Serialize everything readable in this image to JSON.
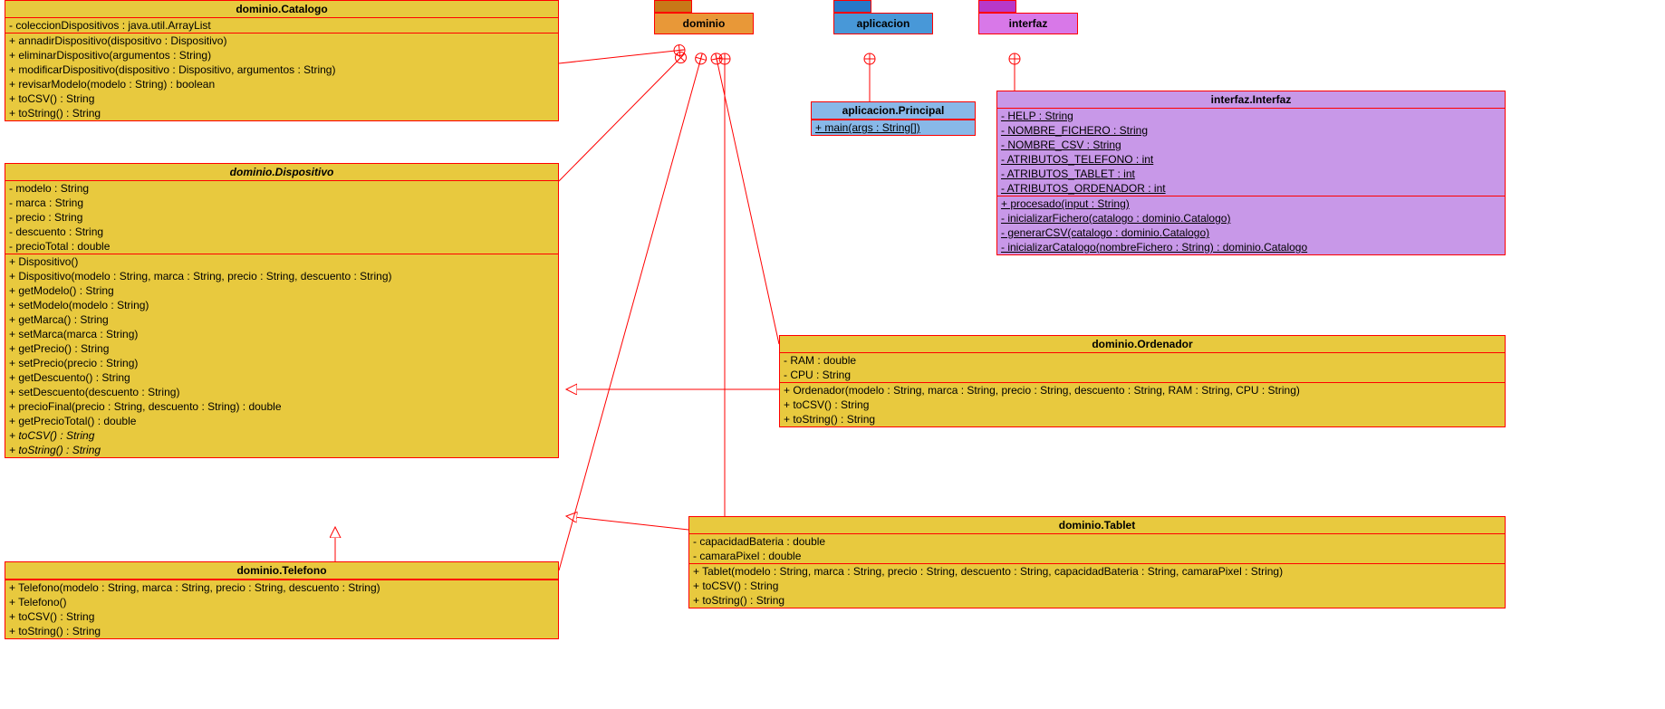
{
  "pkgs": {
    "dominio": "dominio",
    "aplicacion": "aplicacion",
    "interfaz": "interfaz"
  },
  "catalogo": {
    "title": "dominio.Catalogo",
    "a0": "- coleccionDispositivos : java.util.ArrayList",
    "m0": "+ annadirDispositivo(dispositivo : Dispositivo)",
    "m1": "+ eliminarDispositivo(argumentos : String)",
    "m2": "+ modificarDispositivo(dispositivo : Dispositivo, argumentos : String)",
    "m3": "+ revisarModelo(modelo : String) : boolean",
    "m4": "+ toCSV() : String",
    "m5": "+ toString() : String"
  },
  "disp": {
    "title": "dominio.Dispositivo",
    "a0": "- modelo : String",
    "a1": "- marca : String",
    "a2": "- precio : String",
    "a3": "- descuento : String",
    "a4": "- precioTotal : double",
    "m0": "+ Dispositivo()",
    "m1": "+ Dispositivo(modelo : String, marca : String, precio : String, descuento : String)",
    "m2": "+ getModelo() : String",
    "m3": "+ setModelo(modelo : String)",
    "m4": "+ getMarca() : String",
    "m5": "+ setMarca(marca : String)",
    "m6": "+ getPrecio() : String",
    "m7": "+ setPrecio(precio : String)",
    "m8": "+ getDescuento() : String",
    "m9": "+ setDescuento(descuento : String)",
    "m10": "+ precioFinal(precio : String, descuento : String) : double",
    "m11": "+ getPrecioTotal() : double",
    "m12": "+ toCSV() : String",
    "m13": "+ toString() : String"
  },
  "tel": {
    "title": "dominio.Telefono",
    "m0": "+ Telefono(modelo : String, marca : String, precio : String, descuento : String)",
    "m1": "+ Telefono()",
    "m2": "+ toCSV() : String",
    "m3": "+ toString() : String"
  },
  "ord": {
    "title": "dominio.Ordenador",
    "a0": "- RAM : double",
    "a1": "- CPU : String",
    "m0": "+ Ordenador(modelo : String, marca : String, precio : String, descuento : String, RAM : String, CPU : String)",
    "m1": "+ toCSV() : String",
    "m2": "+ toString() : String"
  },
  "tab": {
    "title": "dominio.Tablet",
    "a0": "- capacidadBateria : double",
    "a1": "- camaraPixel : double",
    "m0": "+ Tablet(modelo : String, marca : String, precio : String, descuento : String, capacidadBateria : String, camaraPixel : String)",
    "m1": "+ toCSV() : String",
    "m2": "+ toString() : String"
  },
  "prin": {
    "title": "aplicacion.Principal",
    "m0": "+ main(args : String[])"
  },
  "intf": {
    "title": "interfaz.Interfaz",
    "a0": "- HELP : String",
    "a1": "- NOMBRE_FICHERO : String",
    "a2": "- NOMBRE_CSV : String",
    "a3": "- ATRIBUTOS_TELEFONO : int",
    "a4": "- ATRIBUTOS_TABLET : int",
    "a5": "- ATRIBUTOS_ORDENADOR : int",
    "m0": "+ procesado(input : String)",
    "m1": "- inicializarFichero(catalogo : dominio.Catalogo)",
    "m2": "- generarCSV(catalogo : dominio.Catalogo)",
    "m3": "- inicializarCatalogo(nombreFichero : String) : dominio.Catalogo"
  }
}
